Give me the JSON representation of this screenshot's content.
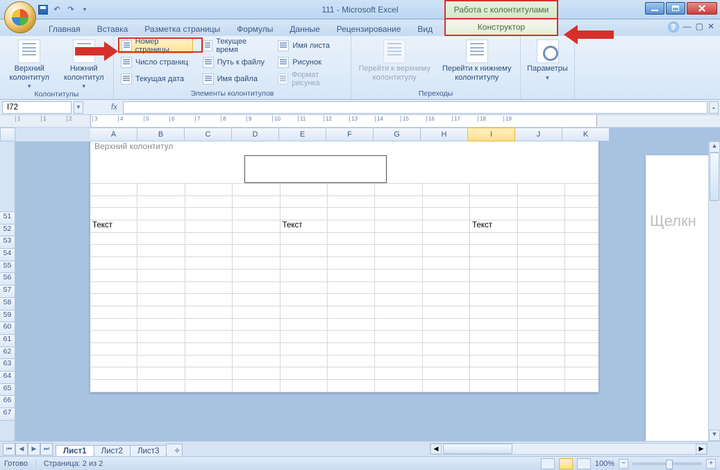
{
  "title": "111 - Microsoft Excel",
  "context_title": "Работа с колонтитулами",
  "tabs": {
    "home": "Главная",
    "insert": "Вставка",
    "layout": "Разметка страницы",
    "formulas": "Формулы",
    "data": "Данные",
    "review": "Рецензирование",
    "view": "Вид"
  },
  "context_tab": "Конструктор",
  "ribbon": {
    "group_hf": "Колонтитулы",
    "top_header": "Верхний колонтитул",
    "bottom_footer": "Нижний колонтитул",
    "group_elements": "Элементы колонтитулов",
    "page_number": "Номер страницы",
    "page_count": "Число страниц",
    "current_date": "Текущая дата",
    "current_time": "Текущее время",
    "file_path": "Путь к файлу",
    "file_name": "Имя файла",
    "sheet_name": "Имя листа",
    "picture": "Рисунок",
    "format_picture": "Формат рисунка",
    "group_nav": "Переходы",
    "goto_header": "Перейти к верхнему колонтитулу",
    "goto_footer": "Перейти к нижнему колонтитулу",
    "group_params": "",
    "params": "Параметры"
  },
  "namebox": "I72",
  "fx": "",
  "header_label": "Верхний колонтитул",
  "columns": [
    "",
    "A",
    "B",
    "C",
    "D",
    "E",
    "F",
    "G",
    "H",
    "I",
    "J",
    "K"
  ],
  "row_numbers": [
    "51",
    "52",
    "53",
    "54",
    "55",
    "56",
    "57",
    "58",
    "59",
    "60",
    "61",
    "62",
    "63",
    "64",
    "65",
    "66",
    "67"
  ],
  "cells": {
    "A54": "Текст",
    "E54": "Текст",
    "I54": "Текст"
  },
  "side_hint": "Щелкн",
  "sheets": {
    "s1": "Лист1",
    "s2": "Лист2",
    "s3": "Лист3"
  },
  "status": {
    "ready": "Готово",
    "page": "Страница: 2 из 2",
    "zoom": "100%"
  },
  "ruler_labels": [
    "1",
    "1",
    "2",
    "3",
    "4",
    "5",
    "6",
    "7",
    "8",
    "9",
    "10",
    "11",
    "12",
    "13",
    "14",
    "15",
    "16",
    "17",
    "18",
    "19"
  ]
}
